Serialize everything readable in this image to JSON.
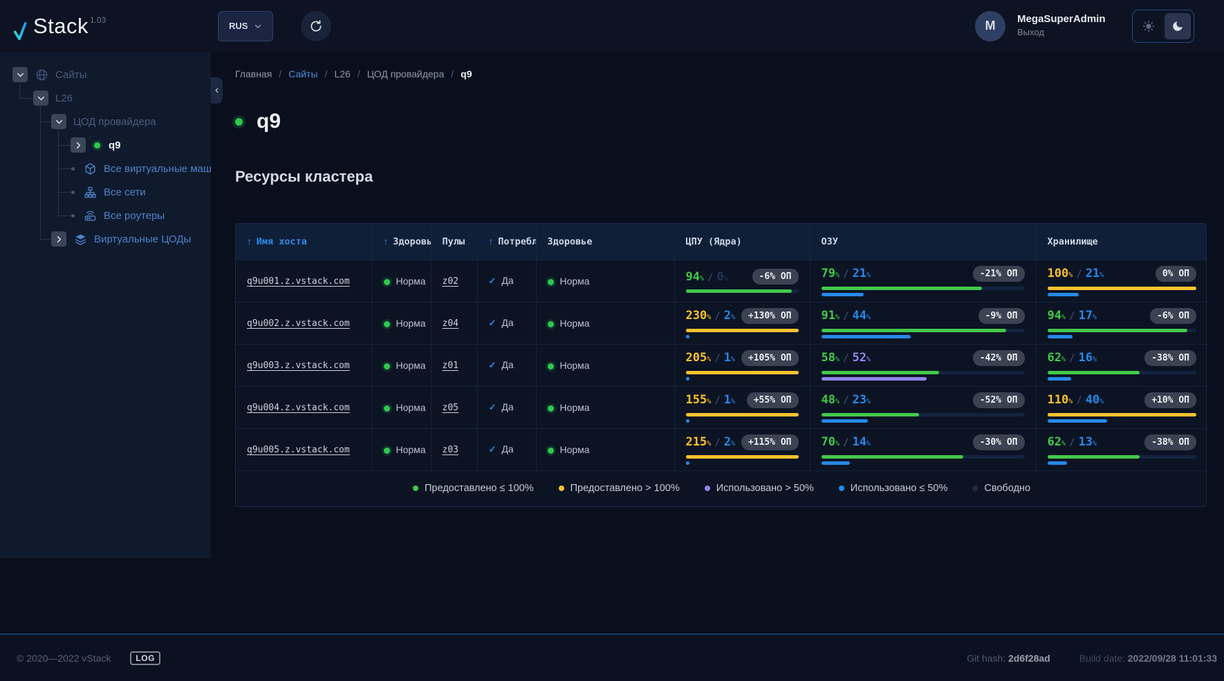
{
  "header": {
    "logo": {
      "mark": "v",
      "text": "Stack",
      "version": "1.03"
    },
    "language": "RUS",
    "avatar_letter": "M",
    "user_name": "MegaSuperAdmin",
    "logout_label": "Выход"
  },
  "sidebar": {
    "tree": [
      {
        "id": "sites",
        "label": "Сайты",
        "depth": 0,
        "expander": "down",
        "icon": "globe",
        "style": "dim"
      },
      {
        "id": "l26",
        "label": "L26",
        "depth": 1,
        "expander": "down",
        "icon": null,
        "style": "dim"
      },
      {
        "id": "dc-provider",
        "label": "ЦОД провайдера",
        "depth": 2,
        "expander": "down",
        "icon": null,
        "style": "dim"
      },
      {
        "id": "q9",
        "label": "q9",
        "depth": 3,
        "expander": "right",
        "icon": "status-dot",
        "style": "active"
      },
      {
        "id": "all-vms",
        "label": "Все виртуальные машины",
        "depth": 3,
        "expander": null,
        "icon": "cube",
        "style": "link"
      },
      {
        "id": "all-networks",
        "label": "Все сети",
        "depth": 3,
        "expander": null,
        "icon": "network",
        "style": "link"
      },
      {
        "id": "all-routers",
        "label": "Все роутеры",
        "depth": 3,
        "expander": null,
        "icon": "router",
        "style": "link"
      },
      {
        "id": "virtual-dcs",
        "label": "Виртуальные ЦОДы",
        "depth": 2,
        "expander": "right",
        "icon": "layers",
        "style": "link"
      }
    ]
  },
  "breadcrumb": [
    {
      "label": "Главная",
      "style": "plain"
    },
    {
      "label": "Сайты",
      "style": "link"
    },
    {
      "label": "L26",
      "style": "plain"
    },
    {
      "label": "ЦОД провайдера",
      "style": "plain"
    },
    {
      "label": "q9",
      "style": "current"
    }
  ],
  "page": {
    "title": "q9",
    "section_title": "Ресурсы кластера"
  },
  "colors": {
    "provided_ok": "#43c94a",
    "provided_over": "#fcc22e",
    "used_low": "#2789e8",
    "used_high": "#8b87ea",
    "free": "#1f2c49",
    "free_text": "#223354",
    "accent": "#2e8be6",
    "health": "#2fc84e"
  },
  "table": {
    "headers": [
      {
        "id": "host",
        "label": "Имя хоста",
        "sorted": true,
        "accent": true
      },
      {
        "id": "health",
        "label": "Здоровье",
        "sorted": true,
        "accent": false
      },
      {
        "id": "pools",
        "label": "Пулы",
        "sorted": false,
        "accent": false
      },
      {
        "id": "consume",
        "label": "Потребл",
        "sorted": true,
        "accent": false
      },
      {
        "id": "health2",
        "label": "Здоровье",
        "sorted": false,
        "accent": false
      },
      {
        "id": "cpu",
        "label": "ЦПУ (Ядра)",
        "sorted": false,
        "accent": false
      },
      {
        "id": "ram",
        "label": "ОЗУ",
        "sorted": false,
        "accent": false
      },
      {
        "id": "storage",
        "label": "Хранилище",
        "sorted": false,
        "accent": false
      }
    ],
    "rows": [
      {
        "host": "q9u001.z.vstack.com",
        "health": "Норма",
        "pool": "z02",
        "consume": "Да",
        "health2": "Норма",
        "cpu": {
          "provided": 94,
          "used": 0,
          "op": "-6% ОП"
        },
        "ram": {
          "provided": 79,
          "used": 21,
          "op": "-21% ОП"
        },
        "storage": {
          "provided": 100,
          "used": 21,
          "op": "0% ОП"
        }
      },
      {
        "host": "q9u002.z.vstack.com",
        "health": "Норма",
        "pool": "z04",
        "consume": "Да",
        "health2": "Норма",
        "cpu": {
          "provided": 230,
          "used": 2,
          "op": "+130% ОП"
        },
        "ram": {
          "provided": 91,
          "used": 44,
          "op": "-9% ОП"
        },
        "storage": {
          "provided": 94,
          "used": 17,
          "op": "-6% ОП"
        }
      },
      {
        "host": "q9u003.z.vstack.com",
        "health": "Норма",
        "pool": "z01",
        "consume": "Да",
        "health2": "Норма",
        "cpu": {
          "provided": 205,
          "used": 1,
          "op": "+105% ОП"
        },
        "ram": {
          "provided": 58,
          "used": 52,
          "op": "-42% ОП"
        },
        "storage": {
          "provided": 62,
          "used": 16,
          "op": "-38% ОП"
        }
      },
      {
        "host": "q9u004.z.vstack.com",
        "health": "Норма",
        "pool": "z05",
        "consume": "Да",
        "health2": "Норма",
        "cpu": {
          "provided": 155,
          "used": 1,
          "op": "+55% ОП"
        },
        "ram": {
          "provided": 48,
          "used": 23,
          "op": "-52% ОП"
        },
        "storage": {
          "provided": 110,
          "used": 40,
          "op": "+10% ОП"
        }
      },
      {
        "host": "q9u005.z.vstack.com",
        "health": "Норма",
        "pool": "z03",
        "consume": "Да",
        "health2": "Норма",
        "cpu": {
          "provided": 215,
          "used": 2,
          "op": "+115% ОП"
        },
        "ram": {
          "provided": 70,
          "used": 14,
          "op": "-30% ОП"
        },
        "storage": {
          "provided": 62,
          "used": 13,
          "op": "-38% ОП"
        }
      }
    ],
    "legend": [
      {
        "color_key": "provided_ok",
        "label": "Предоставлено ≤ 100%"
      },
      {
        "color_key": "provided_over",
        "label": "Предоставлено > 100%"
      },
      {
        "color_key": "used_high",
        "label": "Использовано > 50%"
      },
      {
        "color_key": "used_low",
        "label": "Использовано ≤ 50%"
      },
      {
        "color_key": "free",
        "label": "Свободно"
      }
    ]
  },
  "footer": {
    "copyright": "© 2020—2022 vStack",
    "log_label": "LOG",
    "git_label": "Git hash:",
    "git_value": "2d6f28ad",
    "build_label": "Build date:",
    "build_value": "2022/09/28 11:01:33"
  }
}
